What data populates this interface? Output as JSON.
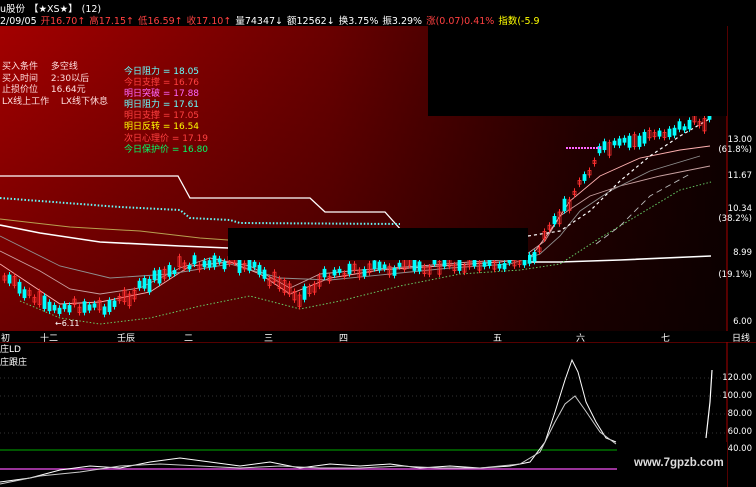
{
  "header": {
    "row1": [
      {
        "text": "u股份",
        "color": "#ffffff"
      },
      {
        "text": "【★XS★】",
        "color": "#ffffff"
      },
      {
        "text": "(12)",
        "color": "#ffffff"
      }
    ],
    "row2": [
      {
        "text": "2/09/05",
        "color": "#ffffff"
      },
      {
        "text": "开16.70↑",
        "color": "#ff4040"
      },
      {
        "text": "高17.15↑",
        "color": "#ff4040"
      },
      {
        "text": "低16.59↑",
        "color": "#ff4040"
      },
      {
        "text": "收17.10↑",
        "color": "#ff4040"
      },
      {
        "text": "量74347↓",
        "color": "#ffffff"
      },
      {
        "text": "额12562↓",
        "color": "#ffffff"
      },
      {
        "text": "换3.75%",
        "color": "#ffffff"
      },
      {
        "text": "振3.29%",
        "color": "#ffffff"
      },
      {
        "text": "涨(0.07)0.41%",
        "color": "#ff4040"
      },
      {
        "text": "指数(-5.9",
        "color": "#ffff00"
      }
    ]
  },
  "info_box": {
    "rows": [
      {
        "label": "买入条件",
        "value": "多空线"
      },
      {
        "label": "买入时间",
        "value": "2:30以后"
      },
      {
        "label": "止损价位",
        "value": "16.64元"
      },
      {
        "label": "LX线上工作",
        "value": "LX线下休息"
      }
    ]
  },
  "levels": [
    {
      "text": "今日阻力 = 18.05",
      "color": "#66ffff"
    },
    {
      "text": "今日支撑 = 16.76",
      "color": "#ff4040"
    },
    {
      "text": "明日突破 = 17.88",
      "color": "#ff66ff"
    },
    {
      "text": "明日阻力 = 17.61",
      "color": "#66ffff"
    },
    {
      "text": "明日支撑 = 17.05",
      "color": "#ff4040"
    },
    {
      "text": "明日反转 = 16.54",
      "color": "#ffff00"
    },
    {
      "text": "次日心理价 = 17.19",
      "color": "#ff4040"
    },
    {
      "text": "今日保护价 = 16.80",
      "color": "#00ff66"
    }
  ],
  "y_axis": {
    "ticks": [
      "13.00",
      "11.67",
      "10.34",
      "8.99",
      "6.00"
    ],
    "pcts": [
      "(61.8%)",
      "(38.2%)",
      "(19.1%)"
    ]
  },
  "x_axis": {
    "labels": [
      "初",
      "十二",
      "壬辰",
      "二",
      "三",
      "四",
      "五",
      "六",
      "七",
      "日线"
    ]
  },
  "lower_panel": {
    "title": "庄LD",
    "subtitle": "庄跟庄",
    "ticks": [
      "120.00",
      "100.00",
      "80.00",
      "60.00",
      "40.00"
    ]
  },
  "watermark": "www.7gpzb.com",
  "colors": {
    "up": "#ff3030",
    "down": "#00ffff",
    "bg_main_left": "#a00000",
    "bg_main_right": "#1a0000"
  }
}
